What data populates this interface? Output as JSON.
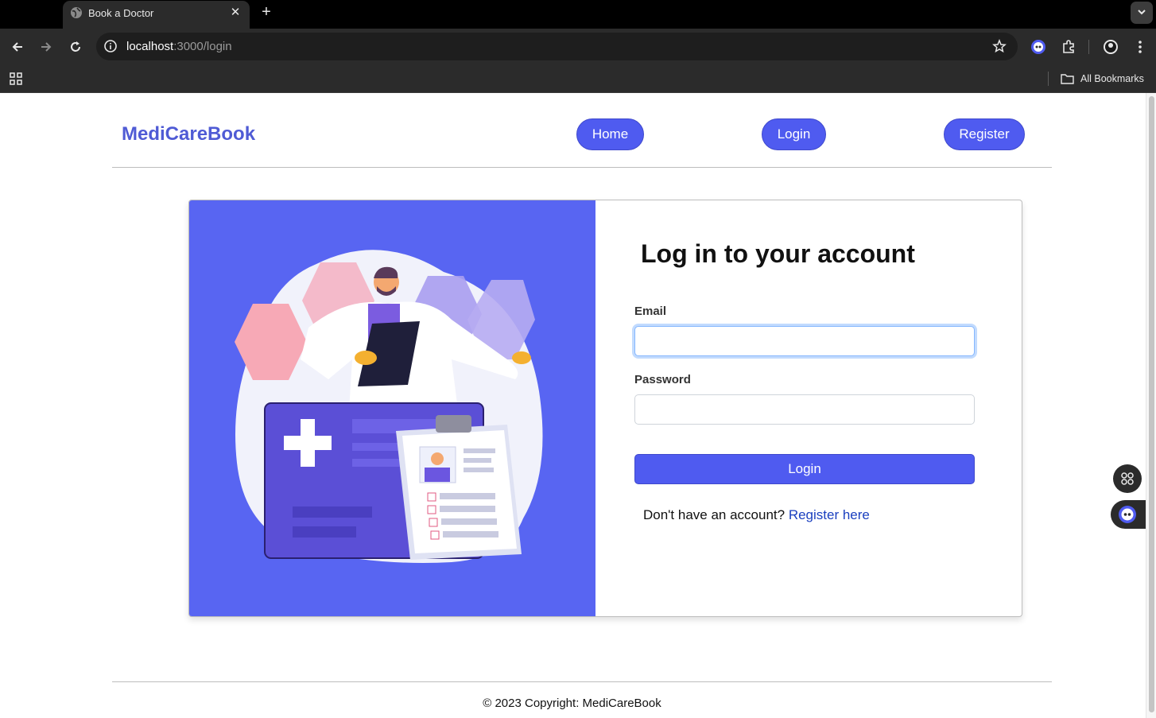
{
  "browser": {
    "tab_title": "Book a Doctor",
    "tab_close": "✕",
    "new_tab": "+",
    "url_host": "localhost",
    "url_path": ":3000/login",
    "all_bookmarks": "All Bookmarks"
  },
  "navbar": {
    "brand": "MediCareBook",
    "links": [
      {
        "label": "Home"
      },
      {
        "label": "Login"
      },
      {
        "label": "Register"
      }
    ]
  },
  "login_form": {
    "title": "Log in to your account",
    "email_label": "Email",
    "email_value": "",
    "password_label": "Password",
    "password_value": "",
    "submit_label": "Login",
    "register_prompt": "Don't have an account?",
    "register_link": "Register here"
  },
  "footer": {
    "text": "© 2023 Copyright: MediCareBook"
  },
  "colors": {
    "primary": "#4f5bf0",
    "brand_text": "#4f5bd5",
    "illustration_bg": "#5865f2",
    "link": "#1a3fbf"
  },
  "icons": [
    "globe-icon",
    "close-icon",
    "plus-icon",
    "chevron-down-icon",
    "back-arrow-icon",
    "forward-arrow-icon",
    "reload-icon",
    "site-info-icon",
    "star-icon",
    "extension-icon",
    "puzzle-icon",
    "profile-icon",
    "more-icon",
    "apps-grid-icon",
    "folder-icon"
  ]
}
